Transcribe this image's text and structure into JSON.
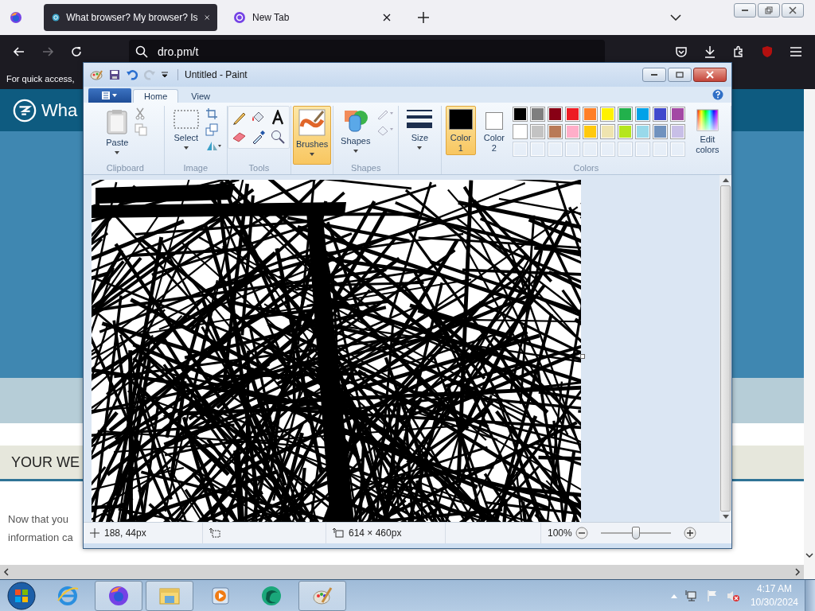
{
  "browser": {
    "tabs": [
      {
        "title": "What browser? My browser? Is",
        "selected": true
      },
      {
        "title": "New Tab",
        "selected": false
      }
    ],
    "address": "dro.pm/t",
    "bookmarks_hint": "For quick access,",
    "page": {
      "site_title": "Wha",
      "section_heading": "YOUR WE",
      "body": [
        "Now that you",
        "information ca"
      ]
    }
  },
  "paint": {
    "title": "Untitled - Paint",
    "tabs": [
      {
        "label": "Home",
        "selected": true
      },
      {
        "label": "View",
        "selected": false
      }
    ],
    "ribbon": {
      "clipboard": {
        "label": "Clipboard",
        "paste": "Paste"
      },
      "image": {
        "label": "Image",
        "select": "Select"
      },
      "tools": {
        "label": "Tools"
      },
      "brushes": {
        "label": "Brushes",
        "selected": true
      },
      "shapes": {
        "label": "Shapes",
        "button": "Shapes"
      },
      "size": {
        "label": "Size"
      },
      "colors": {
        "label": "Colors",
        "color_1": {
          "label": "Color 1",
          "color": "#000000",
          "selected": true
        },
        "color_2": {
          "label": "Color 2",
          "color": "#ffffff",
          "selected": false
        },
        "palette": [
          {
            "color": "#000000"
          },
          {
            "color": "#7f7f7f"
          },
          {
            "color": "#880015"
          },
          {
            "color": "#ed1c24"
          },
          {
            "color": "#ff7f27"
          },
          {
            "color": "#fff200"
          },
          {
            "color": "#22b14c"
          },
          {
            "color": "#00a2e8"
          },
          {
            "color": "#3f48cc"
          },
          {
            "color": "#a349a4"
          },
          {
            "color": "#ffffff"
          },
          {
            "color": "#c3c3c3"
          },
          {
            "color": "#b97a57"
          },
          {
            "color": "#ffaec9"
          },
          {
            "color": "#ffc90e"
          },
          {
            "color": "#efe4b0"
          },
          {
            "color": "#b5e61d"
          },
          {
            "color": "#99d9ea"
          },
          {
            "color": "#7092be"
          },
          {
            "color": "#c8bfe7"
          }
        ],
        "edit_colors": "Edit colors"
      }
    },
    "status": {
      "cursor": "188, 44px",
      "canvas_size": "614 × 460px",
      "zoom": "100%"
    },
    "zoom_slider": {
      "level": 0.5
    }
  },
  "taskbar": {
    "time": "4:17 AM",
    "date": "10/30/2024"
  }
}
